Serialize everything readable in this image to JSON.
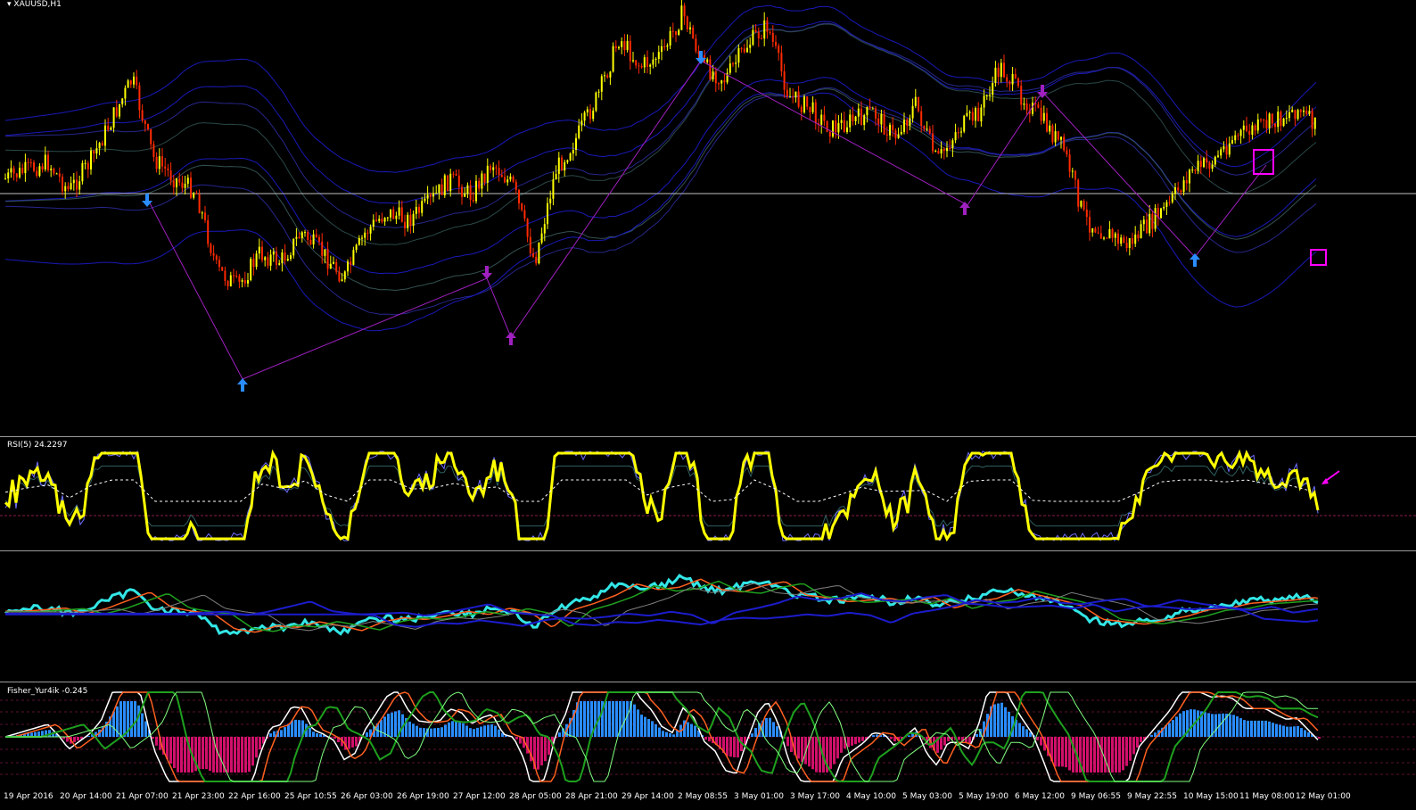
{
  "window": {
    "title": "XAUUSD,H1"
  },
  "panes": {
    "rsi": {
      "label": "RSI(5) 24.2297"
    },
    "fisher": {
      "label": "Fisher_Yur4ik -0.245"
    }
  },
  "time_axis": {
    "labels": [
      "19 Apr 2016",
      "20 Apr 14:00",
      "21 Apr 07:00",
      "21 Apr 23:00",
      "22 Apr 16:00",
      "25 Apr 10:55",
      "26 Apr 03:00",
      "26 Apr 19:00",
      "27 Apr 12:00",
      "28 Apr 05:00",
      "28 Apr 21:00",
      "29 Apr 14:00",
      "2 May 08:55",
      "3 May 01:00",
      "3 May 17:00",
      "4 May 10:00",
      "5 May 03:00",
      "5 May 19:00",
      "6 May 12:00",
      "9 May 06:55",
      "9 May 22:55",
      "10 May 15:00",
      "11 May 08:00",
      "12 May 01:00"
    ]
  },
  "colors": {
    "background": "#000000",
    "bull_candle": "#ffff00",
    "bear_candle": "#ff2a00",
    "rsi_line": "#ffff00",
    "fast_line": "#33e6e6",
    "band_blue": "#1c1ccc",
    "arrow_blue": "#2a8cff",
    "arrow_purple": "#a020c0",
    "marker_magenta": "#ff00ff",
    "histogram_blue": "#2a8cff",
    "histogram_magenta": "#d0106a"
  },
  "chart_data": {
    "type": "candlestick",
    "symbol": "XAUUSD",
    "timeframe": "H1",
    "close_trend": [
      0.58,
      0.6,
      0.62,
      0.55,
      0.62,
      0.72,
      0.82,
      0.63,
      0.58,
      0.55,
      0.36,
      0.32,
      0.4,
      0.38,
      0.45,
      0.4,
      0.34,
      0.45,
      0.5,
      0.48,
      0.52,
      0.58,
      0.54,
      0.62,
      0.56,
      0.38,
      0.6,
      0.68,
      0.78,
      0.92,
      0.85,
      0.88,
      0.98,
      0.85,
      0.82,
      0.9,
      0.95,
      0.78,
      0.75,
      0.7,
      0.72,
      0.74,
      0.68,
      0.76,
      0.62,
      0.7,
      0.74,
      0.85,
      0.78,
      0.72,
      0.65,
      0.48,
      0.45,
      0.42,
      0.47,
      0.52,
      0.6,
      0.62,
      0.68,
      0.7,
      0.72,
      0.75,
      0.7
    ],
    "rsi": {
      "period": 5,
      "value": 24.2297
    },
    "fisher": {
      "name": "Fisher_Yur4ik",
      "value": -0.245
    }
  }
}
